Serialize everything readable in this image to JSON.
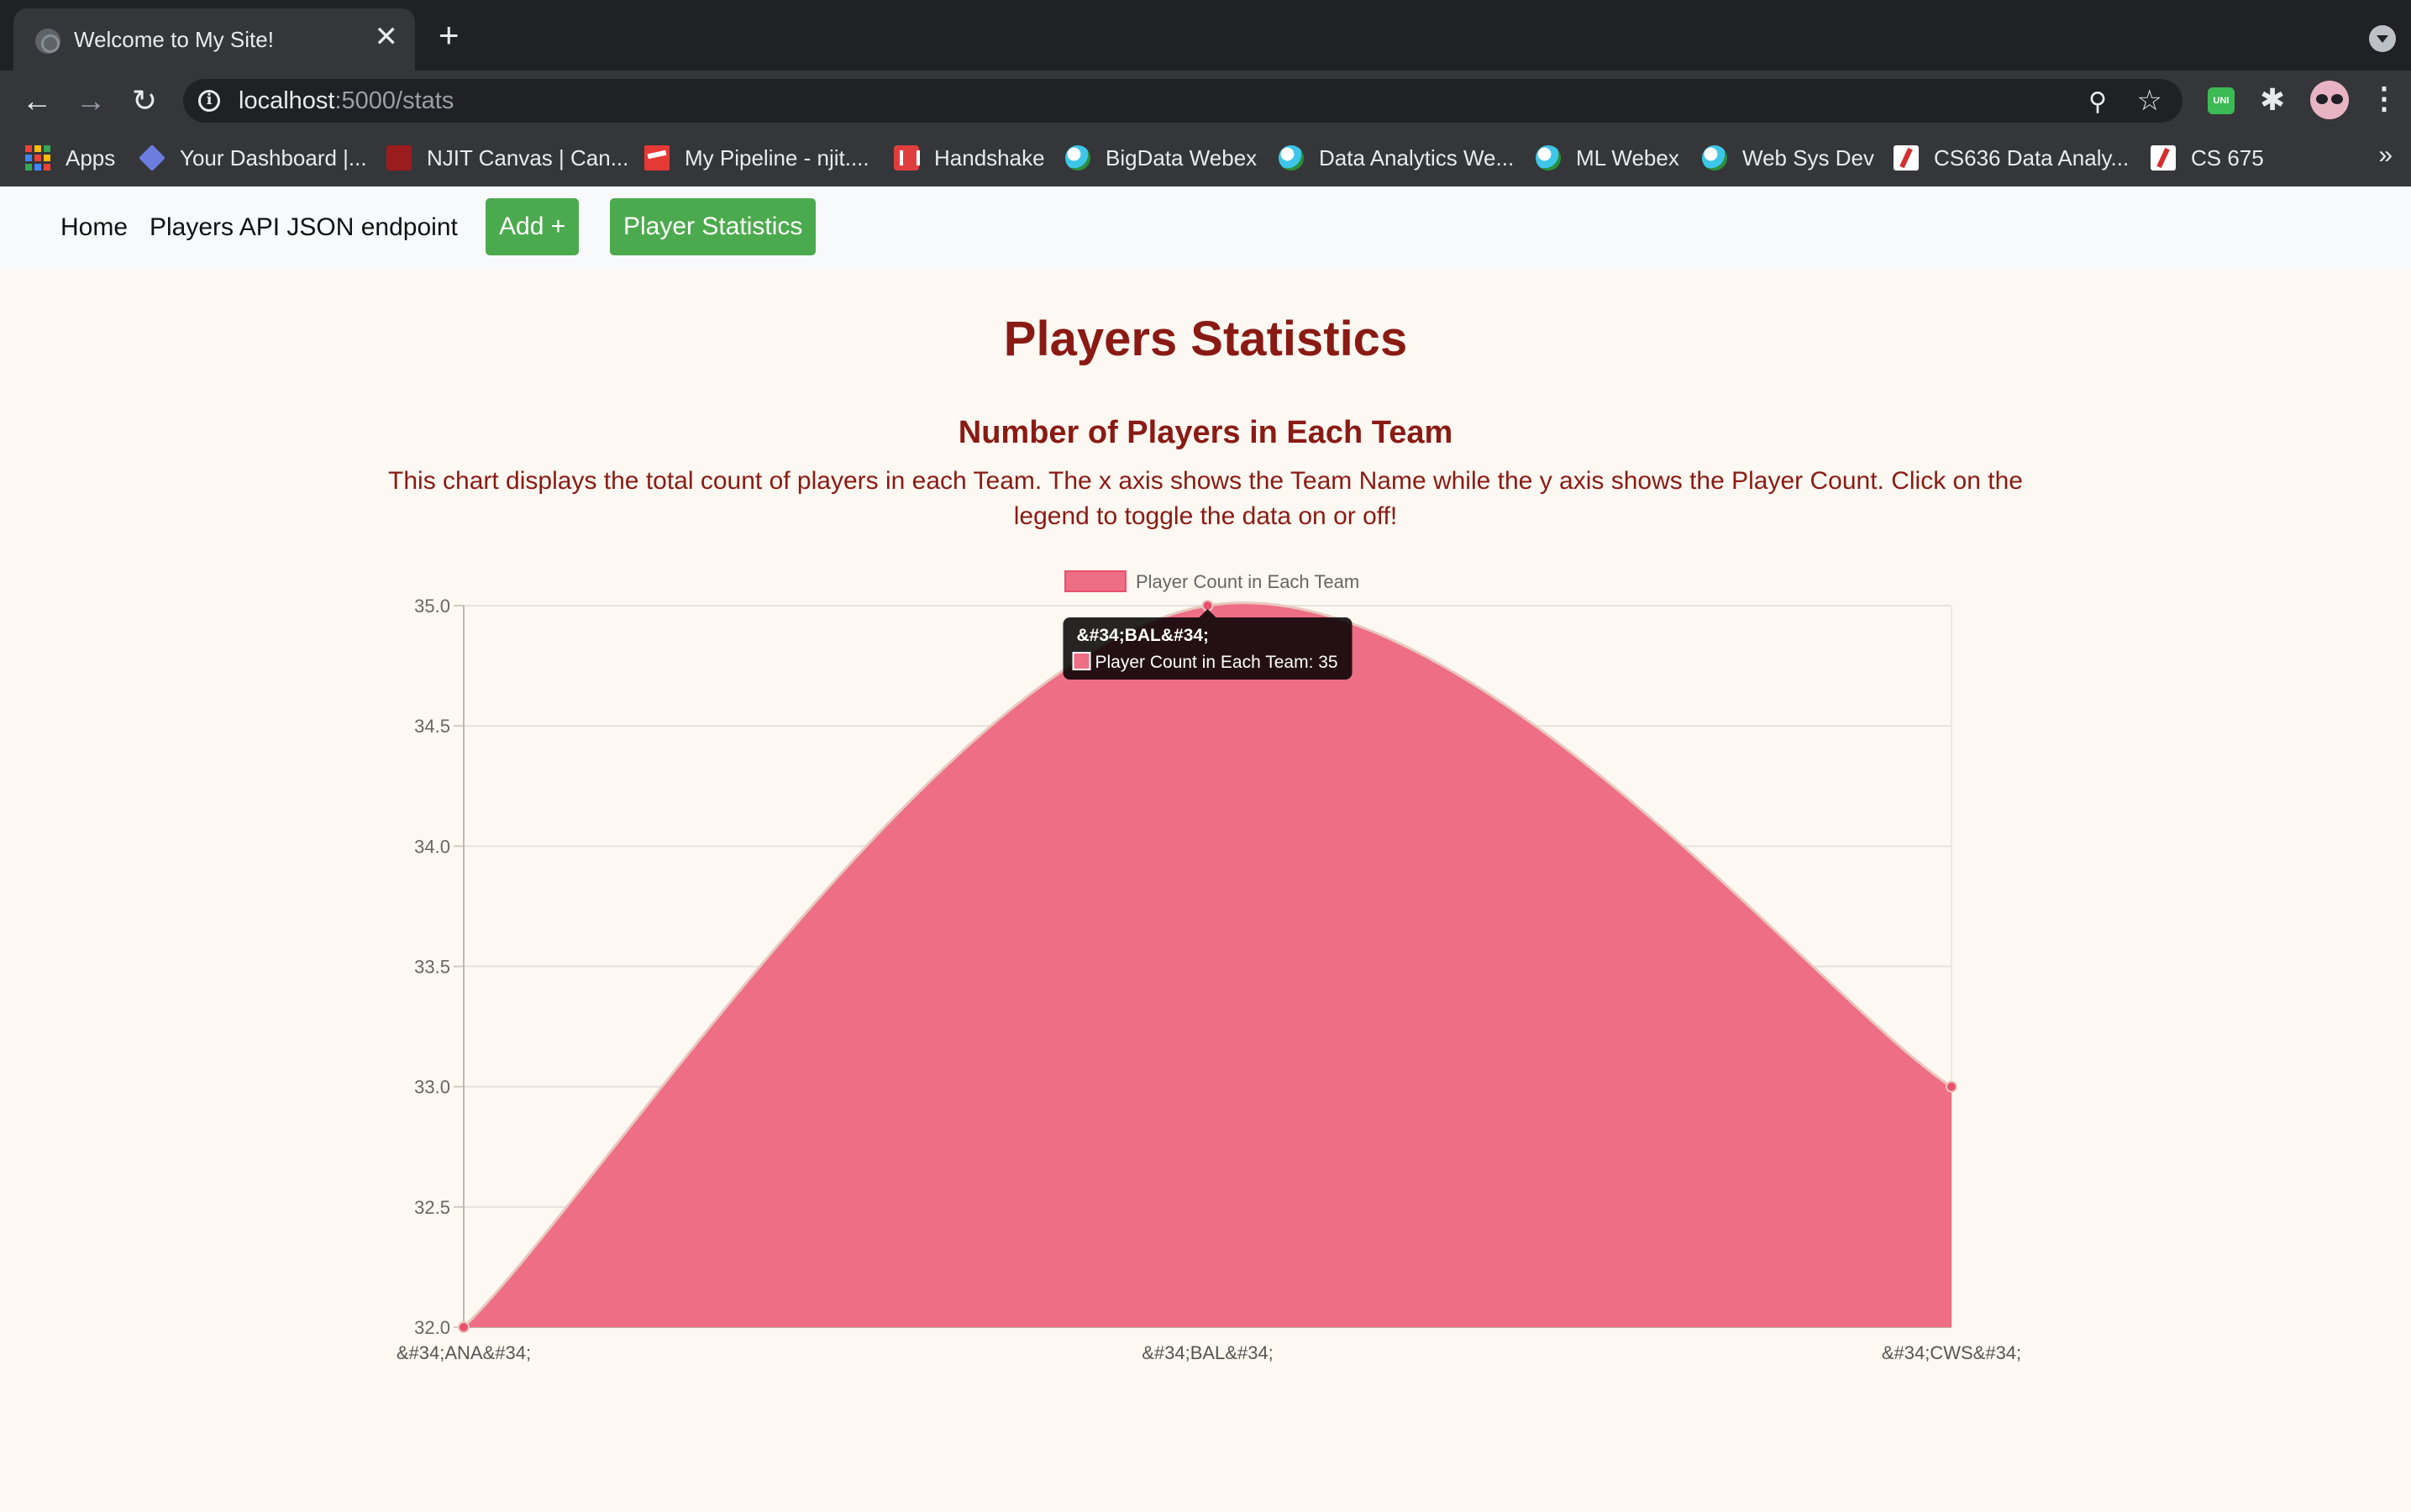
{
  "browser": {
    "tab_title": "Welcome to My Site!",
    "tab_close": "✕",
    "new_tab": "+",
    "url_host": "localhost",
    "url_path": ":5000/stats",
    "more_bookmarks": "»",
    "bookmarks": [
      {
        "label": "Apps",
        "icon": "apps-grid-icon"
      },
      {
        "label": "Your Dashboard |...",
        "icon": "diamond-icon"
      },
      {
        "label": "NJIT Canvas | Can...",
        "icon": "njit-icon"
      },
      {
        "label": "My Pipeline - njit....",
        "icon": "pipeline-icon"
      },
      {
        "label": "Handshake",
        "icon": "handshake-icon"
      },
      {
        "label": "BigData Webex",
        "icon": "webex-icon"
      },
      {
        "label": "Data Analytics We...",
        "icon": "webex-icon"
      },
      {
        "label": "ML Webex",
        "icon": "webex-icon"
      },
      {
        "label": "Web Sys Dev",
        "icon": "webex-icon"
      },
      {
        "label": "CS636 Data Analy...",
        "icon": "canvas-icon"
      },
      {
        "label": "CS 675",
        "icon": "canvas-icon"
      }
    ],
    "extension_badge": "UNI"
  },
  "nav": {
    "home": "Home",
    "api": "Players API JSON endpoint",
    "add": "Add +",
    "stats": "Player Statistics"
  },
  "page": {
    "title": "Players Statistics",
    "chart_title": "Number of Players in Each Team",
    "chart_description": "This chart displays the total count of players in each Team. The x axis shows the Team Name while the y axis shows the Player Count. Click on the legend to toggle the data on or off!"
  },
  "colors": {
    "fill": "#ee6e85",
    "line": "#e8c7bd",
    "point": "#e8526e",
    "heading": "#8a1a14",
    "button": "#4caa4e"
  },
  "chart_data": {
    "type": "area",
    "categories": [
      "&#34;ANA&#34;",
      "&#34;BAL&#34;",
      "&#34;CWS&#34;"
    ],
    "series": [
      {
        "name": "Player Count in Each Team",
        "values": [
          32,
          35,
          33
        ]
      }
    ],
    "ylim": [
      32,
      35
    ],
    "yticks": [
      "35.0",
      "34.5",
      "34.0",
      "33.5",
      "33.0",
      "32.5",
      "32.0"
    ],
    "legend": "top-center",
    "grid": true,
    "tooltip": {
      "title": "&#34;BAL&#34;",
      "label": "Player Count in Each Team: 35"
    }
  }
}
